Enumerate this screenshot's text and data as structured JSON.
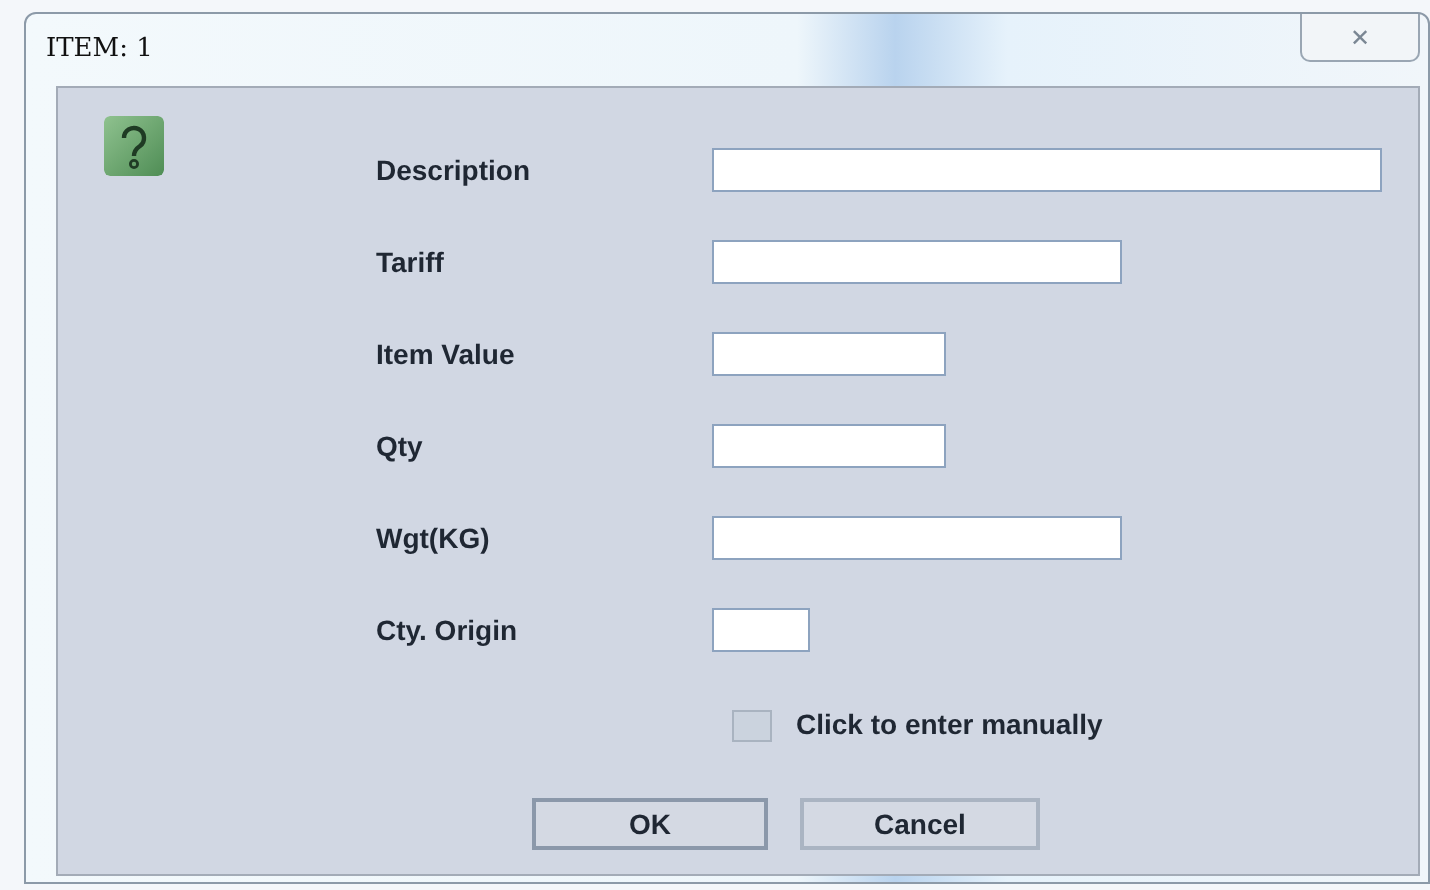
{
  "window": {
    "title": "ITEM: 1",
    "close_label": "✕"
  },
  "fields": [
    {
      "label": "Description"
    },
    {
      "label": "Tariff"
    },
    {
      "label": "Item Value"
    },
    {
      "label": "Qty"
    },
    {
      "label": "Wgt(KG)"
    },
    {
      "label": "Cty. Origin"
    }
  ],
  "manual_checkbox": {
    "label": "Click to enter manually",
    "checked": false
  },
  "buttons": [
    "OK",
    "Cancel"
  ]
}
